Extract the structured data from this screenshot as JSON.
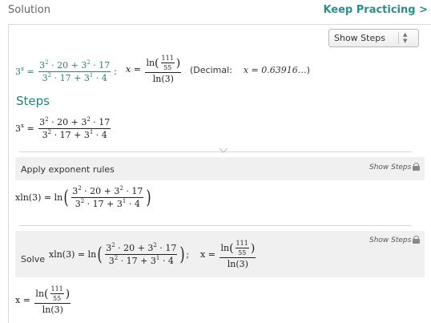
{
  "header": {
    "title": "Solution",
    "keep_practicing": "Keep Practicing >"
  },
  "show_steps_select": {
    "value": "Show Steps"
  },
  "main_equation": {
    "lhs_base": "3",
    "lhs_exp": "x",
    "num": {
      "a": "3",
      "a_exp": "2",
      "b": " · 20 + ",
      "c": "3",
      "c_exp": "2",
      "d": " · 17"
    },
    "den": {
      "a": "3",
      "a_exp": "2",
      "b": " · 17 + ",
      "c": "3",
      "c_exp": "1",
      "d": " · 4"
    }
  },
  "answer": {
    "colon": ":",
    "var": "x",
    "equals": "=",
    "ln": "ln",
    "inner_num": "111",
    "inner_den": "55",
    "den": "ln(3)",
    "decimal_label": "Decimal:",
    "decimal_value": "x = 0.63916…"
  },
  "steps": {
    "title": "Steps",
    "step1": {
      "title": "Apply exponent rules",
      "show_steps": "Show Steps",
      "lhs": "xln(3) =",
      "ln": "ln"
    },
    "step2": {
      "solve_label": "Solve",
      "show_steps": "Show Steps",
      "lhs": "xln(3) =",
      "ln": "ln",
      "colon": ";",
      "var": "x ="
    },
    "final": {
      "var": "x ="
    }
  }
}
